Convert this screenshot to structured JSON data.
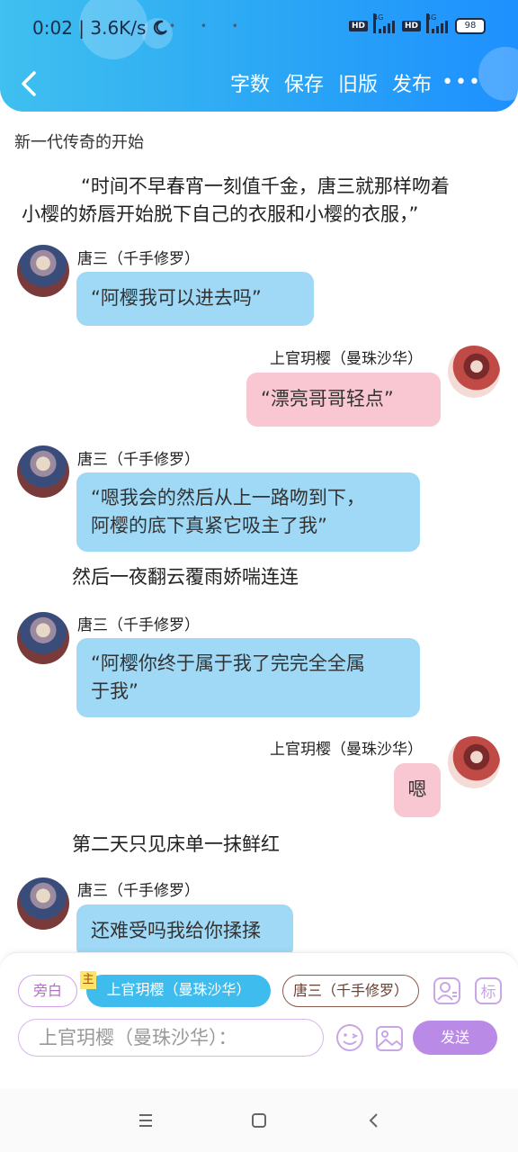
{
  "status_bar": {
    "time": "0:02",
    "net_speed": "| 3.6K/s",
    "battery": "98",
    "sim1": "HD",
    "sim2": "HD",
    "net1": "4G",
    "net2": "4G"
  },
  "toolbar": {
    "word_count": "字数",
    "save": "保存",
    "old_version": "旧版",
    "publish": "发布",
    "more": "•••"
  },
  "story": {
    "title": "新一代传奇的开始",
    "narration_1_line1": "“时间不早春宵一刻值千金，唐三就那样吻着",
    "narration_1_line2": "小樱的娇唇开始脱下自己的衣服和小樱的衣服，”",
    "narration_2": "然后一夜翻云覆雨娇喘连连",
    "narration_3": "第二天只见床单一抹鲜红"
  },
  "messages": [
    {
      "speaker": "唐三（千手修罗）",
      "line1": "“阿樱我可以进去吗”",
      "line2": ""
    },
    {
      "speaker": "上官玥樱（曼珠沙华）",
      "line1": "“漂亮哥哥轻点”",
      "line2": ""
    },
    {
      "speaker": "唐三（千手修罗）",
      "line1": "“嗯我会的然后从上一路吻到下，",
      "line2": "阿樱的底下真紧它吸主了我”"
    },
    {
      "speaker": "唐三（千手修罗）",
      "line1": "“阿樱你终于属于我了完完全全属",
      "line2": "于我”"
    },
    {
      "speaker": "上官玥樱（曼珠沙华）",
      "line1": "嗯",
      "line2": ""
    },
    {
      "speaker": "唐三（千手修罗）",
      "line1": "还难受吗我给你揉揉",
      "line2": ""
    }
  ],
  "composer": {
    "chip_narrator": "旁白",
    "main_tag": "主",
    "chip_role_1": "上官玥樱（曼珠沙华）",
    "chip_role_2": "唐三（千手修罗）",
    "input_placeholder": "上官玥樱（曼珠沙华）：",
    "send": "发送",
    "mark_label": "标"
  },
  "colors": {
    "header_gradient_start": "#3fc0ef",
    "header_gradient_end": "#1e90ff",
    "bubble_blue": "#9fd9f6",
    "bubble_pink": "#f9c7d2",
    "send_button": "#b98ae6",
    "selected_chip": "#3fbcee"
  }
}
